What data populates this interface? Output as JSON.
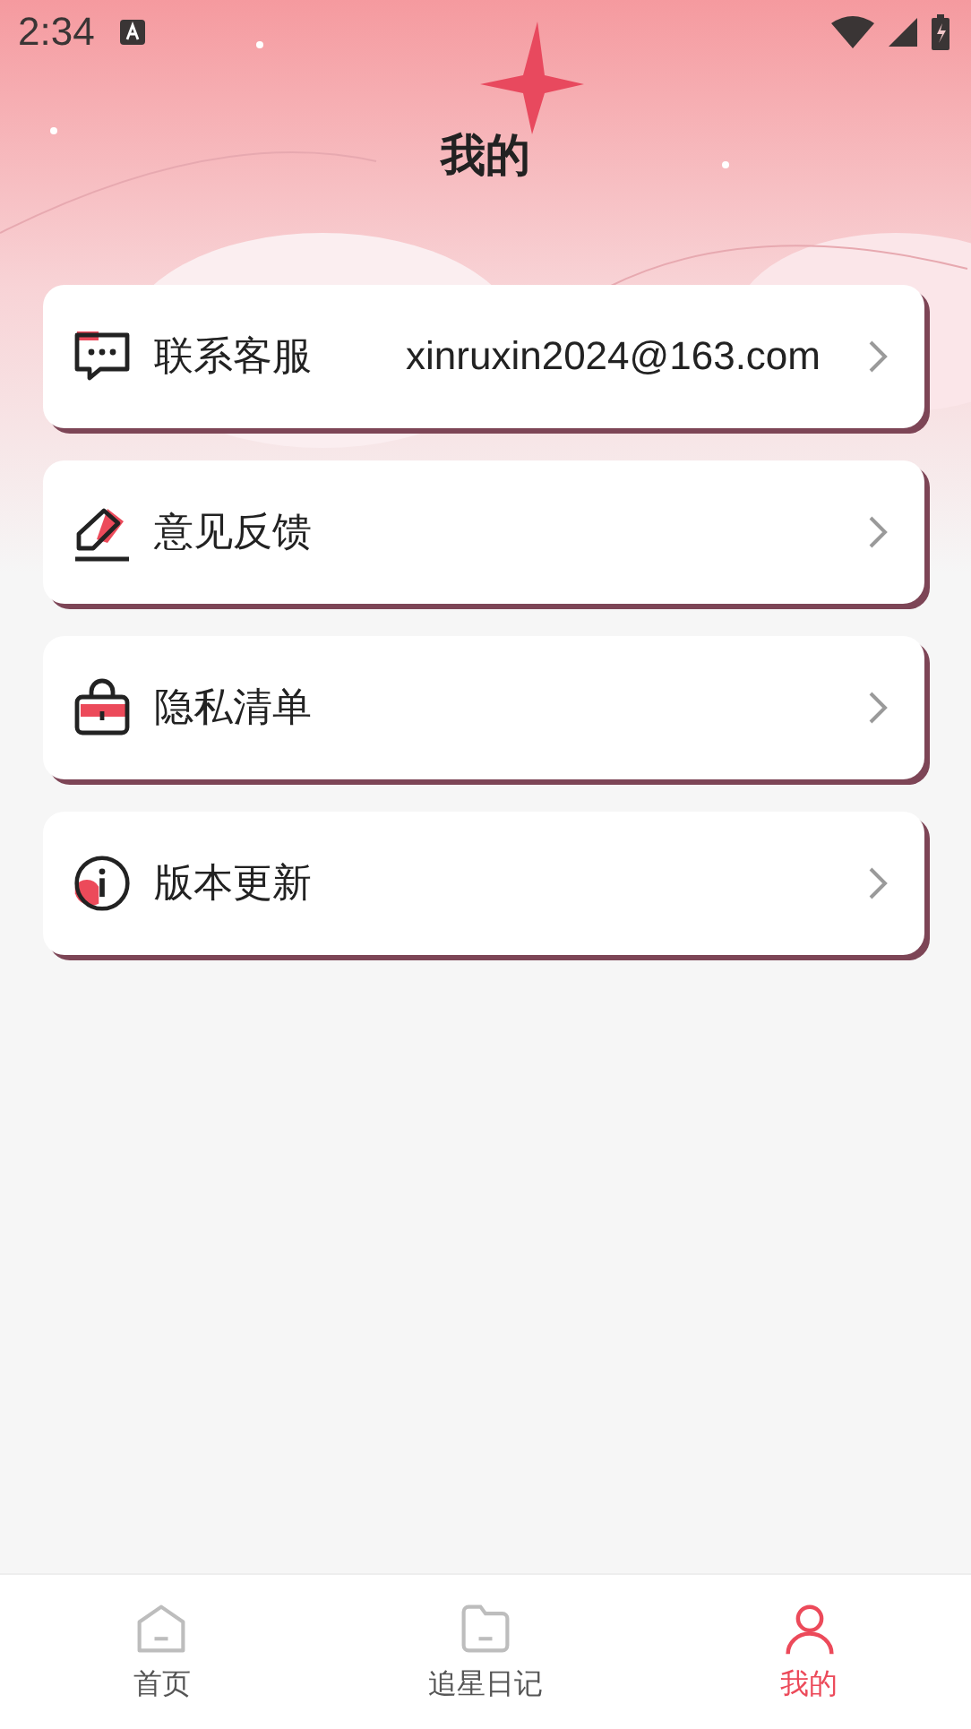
{
  "status_bar": {
    "time": "2:34"
  },
  "header": {
    "title": "我的"
  },
  "menu": [
    {
      "kind": "chat",
      "label": "联系客服",
      "value": "xinruxin2024@163.com"
    },
    {
      "kind": "pen",
      "label": "意见反馈"
    },
    {
      "kind": "bag",
      "label": "隐私清单"
    },
    {
      "kind": "info",
      "label": "版本更新"
    }
  ],
  "tabs": [
    {
      "kind": "home",
      "label": "首页",
      "selected": false
    },
    {
      "kind": "folder",
      "label": "追星日记",
      "selected": false
    },
    {
      "kind": "person",
      "label": "我的",
      "selected": true
    }
  ]
}
